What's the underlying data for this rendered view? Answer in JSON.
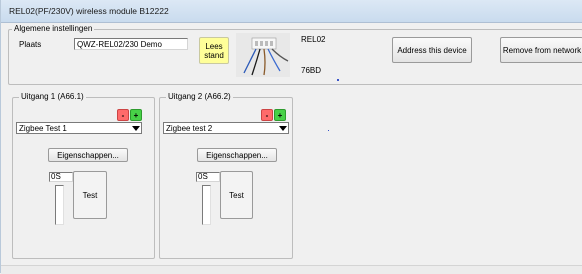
{
  "window": {
    "title": "REL02(PF/230V) wireless module B12222"
  },
  "general": {
    "legend": "Algemene instellingen",
    "location_label": "Plaats",
    "location_value": "QWZ-REL02/230 Demo",
    "read_status_label": "Lees\nstand",
    "device_type": "REL02",
    "device_address": "76BD",
    "address_button": "Address this device",
    "remove_button": "Remove from network"
  },
  "outputs": [
    {
      "legend": "Uitgang 1 (A66.1)",
      "minus": "-",
      "plus": "+",
      "selected": "Zigbee Test 1",
      "properties_button": "Eigenschappen...",
      "time_value": "0S",
      "test_button": "Test"
    },
    {
      "legend": "Uitgang 2 (A66.2)",
      "minus": "-",
      "plus": "+",
      "selected": "Zigbee test 2",
      "properties_button": "Eigenschappen...",
      "time_value": "0S",
      "test_button": "Test"
    }
  ],
  "colors": {
    "minus_button": "#ff6b6b",
    "plus_button": "#47d147",
    "read_button": "#ffff99"
  },
  "icons": {
    "device_image": "relay-module-photo",
    "combo_arrow": "chevron-down-icon"
  }
}
